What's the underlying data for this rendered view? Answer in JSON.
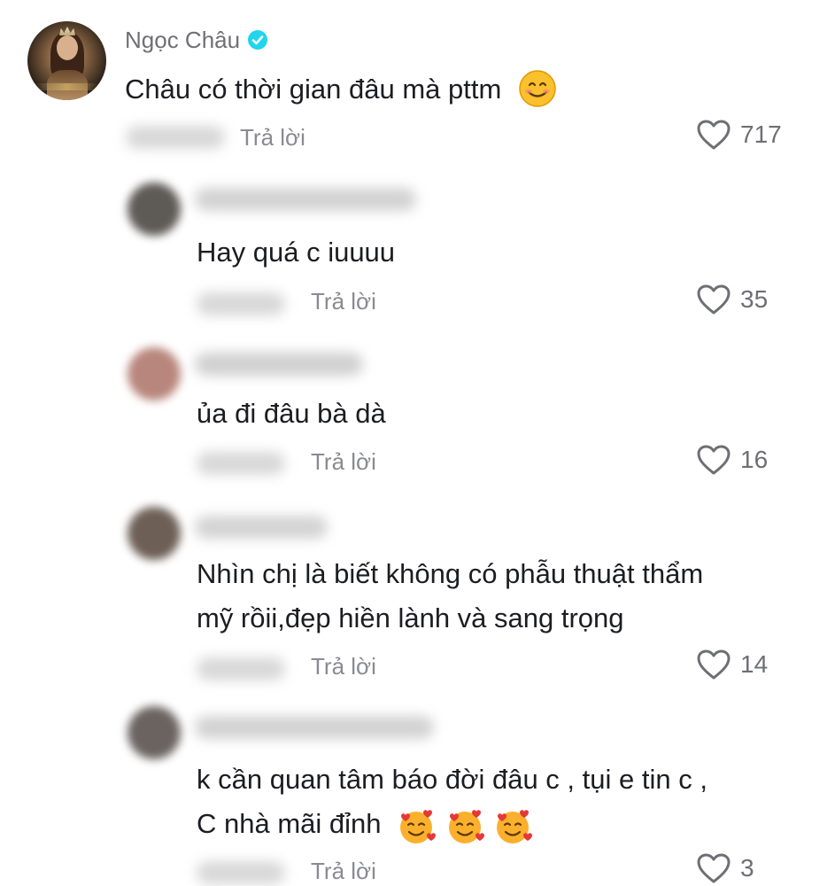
{
  "comment": {
    "author": "Ngọc Châu",
    "verified": true,
    "text": "Châu có thời gian đâu mà pttm",
    "emoji": "smiling-face-emoji",
    "reply_label": "Trả lời",
    "likes": "717"
  },
  "replies": [
    {
      "line1": "Hay quá c iuuuu",
      "line2": "",
      "reply_label": "Trả lời",
      "likes": "35"
    },
    {
      "line1": "ủa đi đâu bà dà",
      "line2": "",
      "reply_label": "Trả lời",
      "likes": "16"
    },
    {
      "line1": "Nhìn chị là biết không có phẫu thuật thẩm",
      "line2": "mỹ rồii,đẹp hiền lành và sang trọng",
      "reply_label": "Trả lời",
      "likes": "14"
    },
    {
      "line1": "k cần quan tâm báo đời đâu c , tụi e tin c ,",
      "line2": "C nhà mãi đỉnh",
      "emoji": "smiling-face-with-hearts-emoji",
      "emoji_count": 3,
      "reply_label": "Trả lời",
      "likes": "3"
    }
  ],
  "colors": {
    "text": "#1c1d22",
    "secondary": "#8a8b91",
    "verified": "#20d5ec"
  }
}
